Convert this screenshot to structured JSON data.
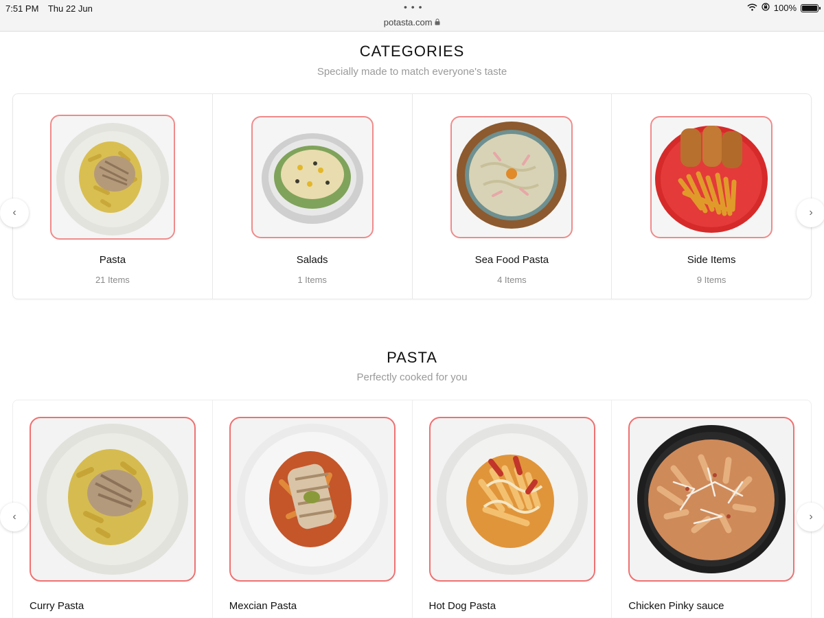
{
  "status_bar": {
    "time": "7:51 PM",
    "date": "Thu 22 Jun",
    "dots": "• • •",
    "url": "potasta.com",
    "battery": "100%",
    "battery_level": 1.0
  },
  "categories": {
    "title": "CATEGORIES",
    "subtitle": "Specially made to match everyone's taste",
    "items": [
      {
        "name": "Pasta",
        "count": "21 Items"
      },
      {
        "name": "Salads",
        "count": "1 Items"
      },
      {
        "name": "Sea Food Pasta",
        "count": "4 Items"
      },
      {
        "name": "Side Items",
        "count": "9 Items"
      }
    ]
  },
  "pasta": {
    "title": "PASTA",
    "subtitle": "Perfectly cooked for you",
    "items": [
      {
        "name": "Curry Pasta"
      },
      {
        "name": "Mexcian Pasta"
      },
      {
        "name": "Hot Dog Pasta"
      },
      {
        "name": "Chicken Pinky sauce"
      }
    ]
  },
  "icons": {
    "prev": "‹",
    "next": "›",
    "lock": "🔒"
  },
  "colors": {
    "card_border_accent": "#f08a8a",
    "subtitle_gray": "#9a9a9a"
  }
}
